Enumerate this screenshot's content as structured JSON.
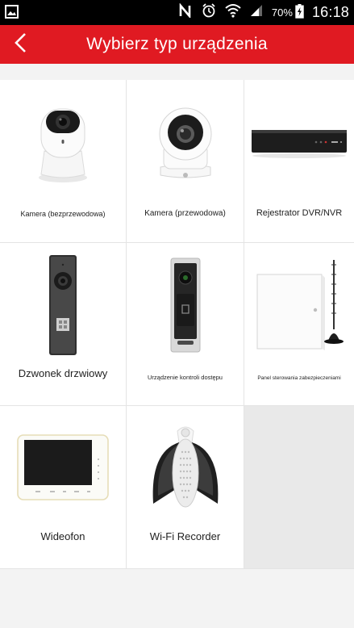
{
  "status_bar": {
    "battery": "70%",
    "time": "16:18"
  },
  "header": {
    "title": "Wybierz typ urządzenia"
  },
  "devices": [
    {
      "label": "Kamera (bezprzewodowa)",
      "icon": "wireless-camera"
    },
    {
      "label": "Kamera (przewodowa)",
      "icon": "wired-camera"
    },
    {
      "label": "Rejestrator DVR/NVR",
      "icon": "dvr-nvr-recorder"
    },
    {
      "label": "Dzwonek drzwiowy",
      "icon": "doorbell"
    },
    {
      "label": "Urządzenie kontroli dostępu",
      "icon": "access-control"
    },
    {
      "label": "Panel sterowania zabezpieczeniami",
      "icon": "security-control-panel"
    },
    {
      "label": "Wideofon",
      "icon": "video-intercom"
    },
    {
      "label": "Wi-Fi Recorder",
      "icon": "wifi-recorder"
    }
  ],
  "colors": {
    "accent": "#e01a22",
    "status_bar": "#000000"
  }
}
